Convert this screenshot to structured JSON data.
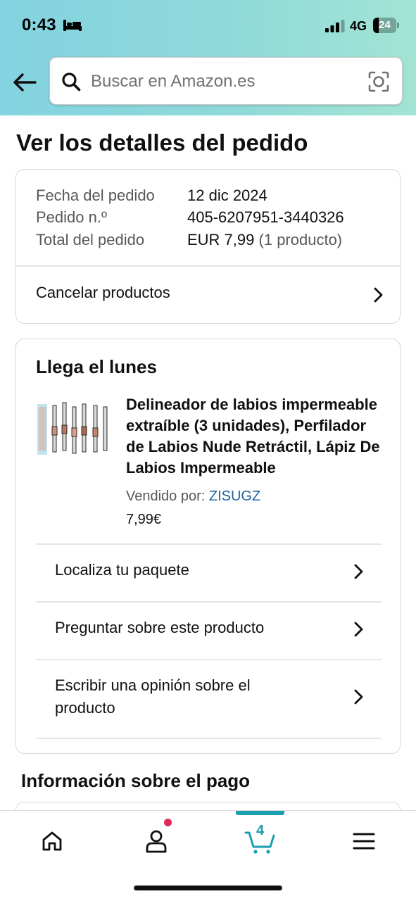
{
  "status_bar": {
    "time": "0:43",
    "network": "4G",
    "battery_level": "24",
    "battery_fraction": 0.24
  },
  "search": {
    "placeholder": "Buscar en Amazon.es"
  },
  "page": {
    "title": "Ver los detalles del pedido"
  },
  "order_summary": {
    "date_label": "Fecha del pedido",
    "date_value": "12 dic 2024",
    "number_label": "Pedido n.º",
    "number_value": "405-6207951-3440326",
    "total_label": "Total del pedido",
    "total_value": "EUR 7,99",
    "total_count": "(1 producto)",
    "cancel_label": "Cancelar productos"
  },
  "delivery": {
    "title": "Llega el lunes",
    "product": {
      "title": "Delineador de labios impermeable extraíble (3 unidades), Perfilador de Labios Nude Retráctil, Lápiz De Labios Impermeable",
      "sold_by_label": "Vendido por: ",
      "seller": "ZISUGZ",
      "price": "7,99€"
    },
    "actions": [
      {
        "label": "Localiza tu paquete"
      },
      {
        "label": "Preguntar sobre este producto"
      },
      {
        "label": "Escribir una opinión sobre el producto"
      }
    ]
  },
  "payment": {
    "title": "Información sobre el pago"
  },
  "bottom_nav": {
    "cart_count": "4",
    "active_tab": "cart",
    "items": [
      "home-icon",
      "account-icon",
      "cart-icon",
      "menu-icon"
    ]
  },
  "colors": {
    "header_gradient_start": "#83d3e0",
    "header_gradient_end": "#a3e5d4",
    "link": "#2162a1",
    "accent": "#1a9fb0",
    "notification_dot": "#e0295b"
  }
}
